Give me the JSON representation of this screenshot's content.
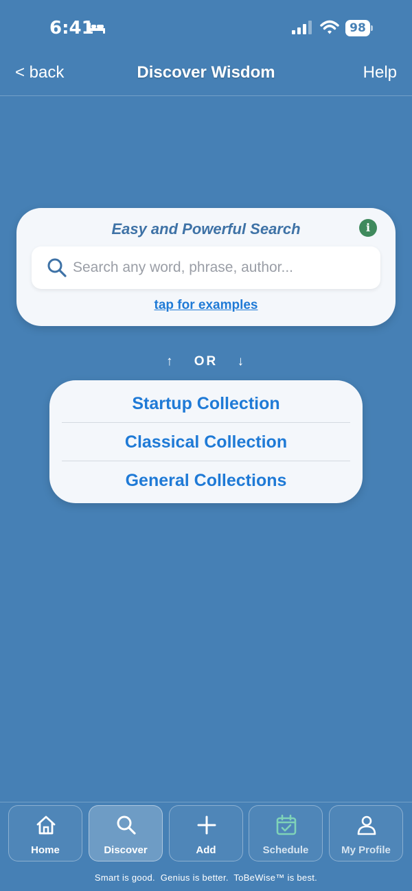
{
  "status_bar": {
    "time": "6:41",
    "battery": "98"
  },
  "nav": {
    "back_label": "< back",
    "title": "Discover Wisdom",
    "help_label": "Help"
  },
  "search": {
    "heading": "Easy and Powerful Search",
    "placeholder": "Search any word, phrase, author...",
    "value": "",
    "examples_link": "tap for examples"
  },
  "divider": {
    "up_arrow": "↑",
    "label": "OR",
    "down_arrow": "↓"
  },
  "collections": {
    "items": [
      {
        "label": "Startup Collection"
      },
      {
        "label": "Classical Collection"
      },
      {
        "label": "General Collections"
      }
    ]
  },
  "tab_bar": {
    "active": "Discover",
    "tabs": [
      {
        "label": "Home",
        "icon": "home-icon"
      },
      {
        "label": "Discover",
        "icon": "search-icon"
      },
      {
        "label": "Add",
        "icon": "plus-icon"
      },
      {
        "label": "Schedule",
        "icon": "calendar-check-icon"
      },
      {
        "label": "My Profile",
        "icon": "person-icon"
      }
    ],
    "tagline": "Smart is good.  Genius is better.  ToBeWise™ is best."
  },
  "colors": {
    "background": "#4680b5",
    "link_blue": "#1f7ad6",
    "info_green": "#3f8a5d",
    "schedule_green": "#7fd3b8"
  }
}
